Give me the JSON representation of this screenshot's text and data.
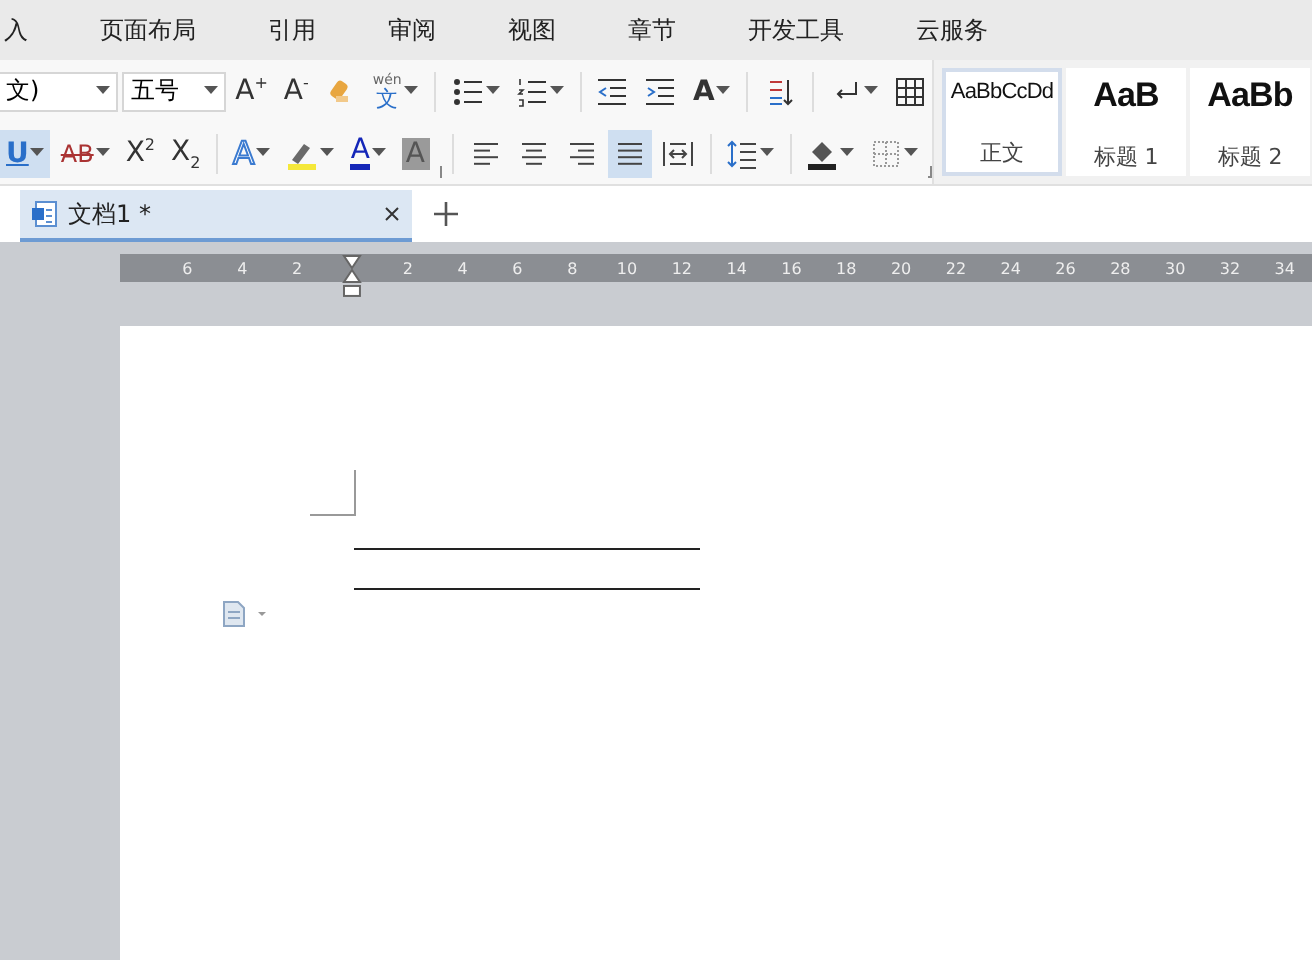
{
  "menu": [
    {
      "label": "入",
      "selected": false
    },
    {
      "label": "页面布局",
      "selected": false
    },
    {
      "label": "引用",
      "selected": false
    },
    {
      "label": "审阅",
      "selected": false
    },
    {
      "label": "视图",
      "selected": false
    },
    {
      "label": "章节",
      "selected": false
    },
    {
      "label": "开发工具",
      "selected": false
    },
    {
      "label": "云服务",
      "selected": false
    }
  ],
  "font": {
    "name": "文)",
    "size": "五号"
  },
  "row1": [
    {
      "kind": "letter",
      "text": "A$^{+}$",
      "dropdown": false,
      "selected": false
    },
    {
      "kind": "letter",
      "text": "A$^{-}$",
      "dropdown": false,
      "selected": false
    },
    {
      "kind": "eraser",
      "dropdown": false,
      "selected": false
    },
    {
      "kind": "pinyin",
      "ruby": "wén",
      "text": "文",
      "dropdown": true,
      "selected": false
    },
    {
      "kind": "sep"
    },
    {
      "kind": "bullets",
      "dropdown": true,
      "selected": false
    },
    {
      "kind": "numbering",
      "dropdown": true,
      "selected": false
    },
    {
      "kind": "sep"
    },
    {
      "kind": "outdent",
      "dropdown": false,
      "selected": false
    },
    {
      "kind": "indent",
      "dropdown": false,
      "selected": false
    },
    {
      "kind": "letter-spacing",
      "text": "A",
      "dropdown": true,
      "selected": false
    },
    {
      "kind": "sep"
    },
    {
      "kind": "sort",
      "dropdown": false,
      "selected": false
    },
    {
      "kind": "sep"
    },
    {
      "kind": "return",
      "dropdown": true,
      "selected": false
    },
    {
      "kind": "table",
      "dropdown": false,
      "selected": false
    }
  ],
  "row2": [
    {
      "kind": "letter-underline",
      "text": "U",
      "dropdown": true,
      "selected": true
    },
    {
      "kind": "letter-strike",
      "text": "AB",
      "dropdown": true,
      "selected": false
    },
    {
      "kind": "letter",
      "text": "X$^{2}$",
      "dropdown": false,
      "selected": false
    },
    {
      "kind": "letter",
      "text": "X$_{2}$",
      "dropdown": false,
      "selected": false
    },
    {
      "kind": "sep"
    },
    {
      "kind": "letter-outline",
      "text": "A",
      "dropdown": true,
      "selected": false
    },
    {
      "kind": "highlight",
      "dropdown": true,
      "selected": false
    },
    {
      "kind": "letter-color",
      "text": "A",
      "dropdown": true,
      "selected": false
    },
    {
      "kind": "letter-shaded",
      "text": "A",
      "dropdown": false,
      "selected": false
    },
    {
      "kind": "launcher"
    },
    {
      "kind": "sep"
    },
    {
      "kind": "align-left",
      "dropdown": false,
      "selected": false
    },
    {
      "kind": "align-center",
      "dropdown": false,
      "selected": false
    },
    {
      "kind": "align-right",
      "dropdown": false,
      "selected": false
    },
    {
      "kind": "justify",
      "dropdown": false,
      "selected": true
    },
    {
      "kind": "distribute",
      "dropdown": false,
      "selected": false
    },
    {
      "kind": "sep"
    },
    {
      "kind": "line-spacing",
      "dropdown": true,
      "selected": false
    },
    {
      "kind": "sep"
    },
    {
      "kind": "fill",
      "dropdown": true,
      "selected": false
    },
    {
      "kind": "border",
      "dropdown": true,
      "selected": false
    },
    {
      "kind": "launcher"
    }
  ],
  "styles": [
    {
      "preview": "AaBbCcDd",
      "label": "正文",
      "kind": "body",
      "selected": true
    },
    {
      "preview": "AaB",
      "label": "标题 1",
      "kind": "heading",
      "selected": false
    },
    {
      "preview": "AaBb",
      "label": "标题 2",
      "kind": "heading",
      "selected": false
    }
  ],
  "tabs": [
    {
      "label": "文档1 *",
      "selected": true
    }
  ],
  "ruler": {
    "left_ticks": [
      "6",
      "4",
      "2"
    ],
    "right_ticks": [
      "2",
      "4",
      "6",
      "8",
      "10",
      "12",
      "14",
      "16",
      "18",
      "20",
      "22",
      "24",
      "26",
      "28",
      "30",
      "32",
      "34"
    ]
  }
}
